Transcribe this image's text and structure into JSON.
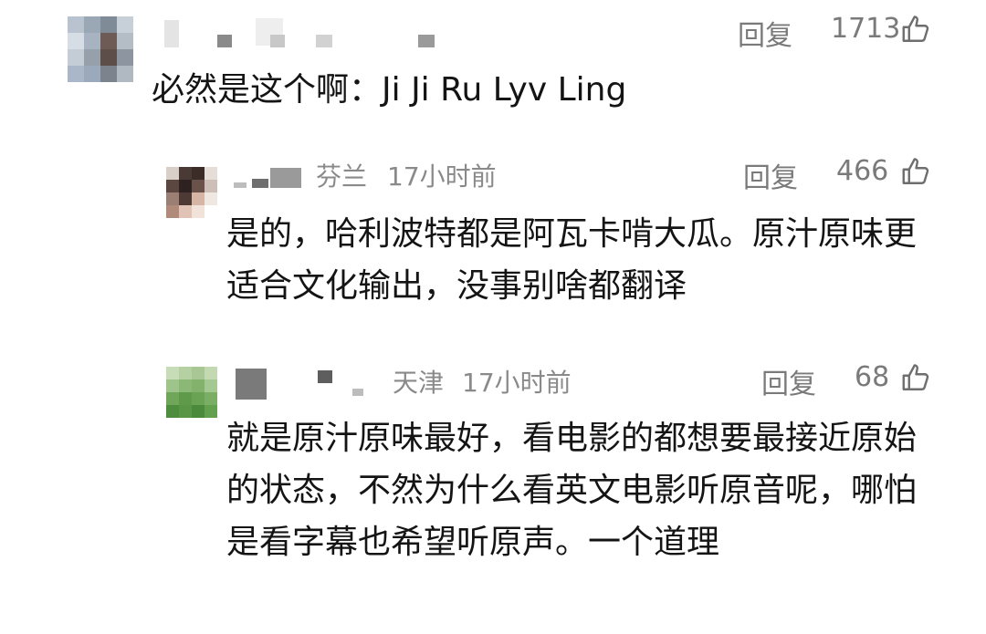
{
  "comments": [
    {
      "location": "",
      "time": "",
      "reply_label": "回复",
      "like_count": "1713",
      "text": "必然是这个啊：Ji Ji Ru Lyv Ling"
    },
    {
      "location": "芬兰",
      "time": "17小时前",
      "reply_label": "回复",
      "like_count": "466",
      "text": "是的，哈利波特都是阿瓦卡啃大瓜。原汁原味更适合文化输出，没事别啥都翻译"
    },
    {
      "location": "天津",
      "time": "17小时前",
      "reply_label": "回复",
      "like_count": "68",
      "text": "就是原汁原味最好，看电影的都想要最接近原始的状态，不然为什么看英文电影听原音呢，哪怕是看字幕也希望听原声。一个道理"
    }
  ],
  "icons": {
    "like": "thumbs-up-icon"
  },
  "colors": {
    "meta": "#8a8a8a",
    "text": "#141414",
    "background": "#ffffff"
  }
}
